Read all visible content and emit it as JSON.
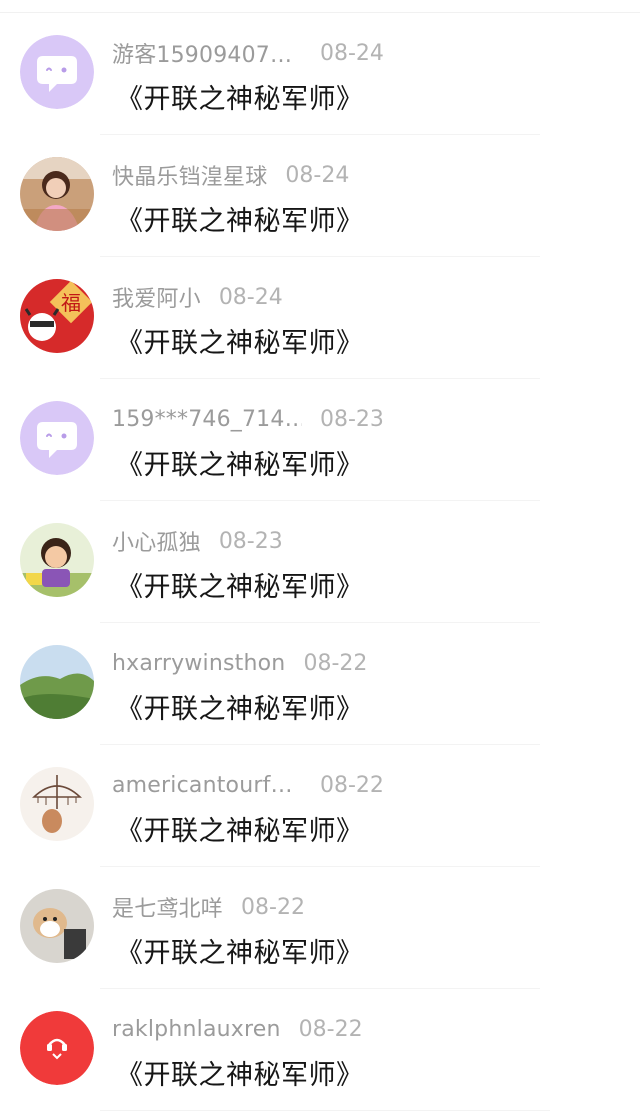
{
  "comments": [
    {
      "username": "游客15909407…",
      "date": "08-24",
      "text": "《开联之神秘军师》",
      "avatar_icon": "default-chat-avatar-icon"
    },
    {
      "username": "快晶乐铛湟星球",
      "date": "08-24",
      "text": "《开联之神秘军师》",
      "avatar_icon": "girl-photo-avatar-icon"
    },
    {
      "username": "我爱阿小",
      "date": "08-24",
      "text": "《开联之神秘军师》",
      "avatar_icon": "fu-cow-avatar-icon"
    },
    {
      "username": "159***746_714…",
      "date": "08-23",
      "text": "《开联之神秘军师》",
      "avatar_icon": "default-chat-avatar-icon"
    },
    {
      "username": "小心孤独",
      "date": "08-23",
      "text": "《开联之神秘军师》",
      "avatar_icon": "cartoon-boy-avatar-icon"
    },
    {
      "username": "hxarrywinsthon",
      "date": "08-22",
      "text": "《开联之神秘军师》",
      "avatar_icon": "green-hills-avatar-icon"
    },
    {
      "username": "americantourf…",
      "date": "08-22",
      "text": "《开联之神秘军师》",
      "avatar_icon": "umbrella-drawing-avatar-icon"
    },
    {
      "username": "是七鸢北咩",
      "date": "08-22",
      "text": "《开联之神秘军师》",
      "avatar_icon": "shiba-dog-avatar-icon"
    },
    {
      "username": "raklphnlauxren",
      "date": "08-22",
      "text": "《开联之神秘军师》",
      "avatar_icon": "red-logo-avatar-icon"
    }
  ],
  "colors": {
    "default_avatar_bg": "#d9c8f7",
    "text_primary": "#161616",
    "text_secondary": "#9b9b9b",
    "red_avatar_bg": "#f03a3a"
  }
}
